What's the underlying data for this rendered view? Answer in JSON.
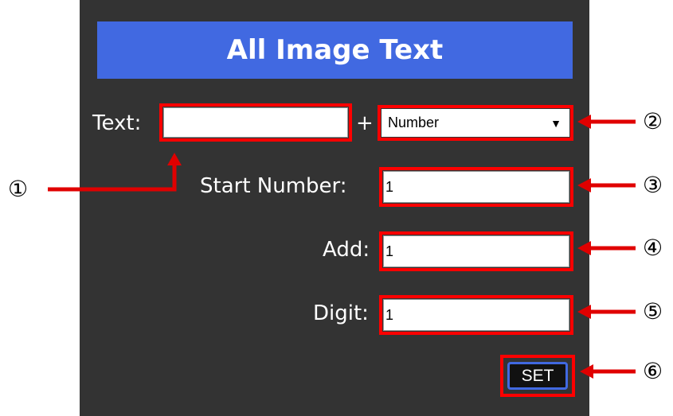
{
  "title": "All Image Text",
  "text_row": {
    "label": "Text:",
    "value": "",
    "plus": "+",
    "select_value": "Number",
    "select_arrow": "▼"
  },
  "start_number": {
    "label": "Start Number:",
    "value": "1"
  },
  "add": {
    "label": "Add:",
    "value": "1"
  },
  "digit": {
    "label": "Digit:",
    "value": "1"
  },
  "set_button": "SET",
  "markers": [
    "①",
    "②",
    "③",
    "④",
    "⑤",
    "⑥"
  ],
  "colors": {
    "panel": "#333333",
    "title_bar": "#4169e1",
    "highlight": "#ff0000",
    "arrow": "#e00000"
  }
}
